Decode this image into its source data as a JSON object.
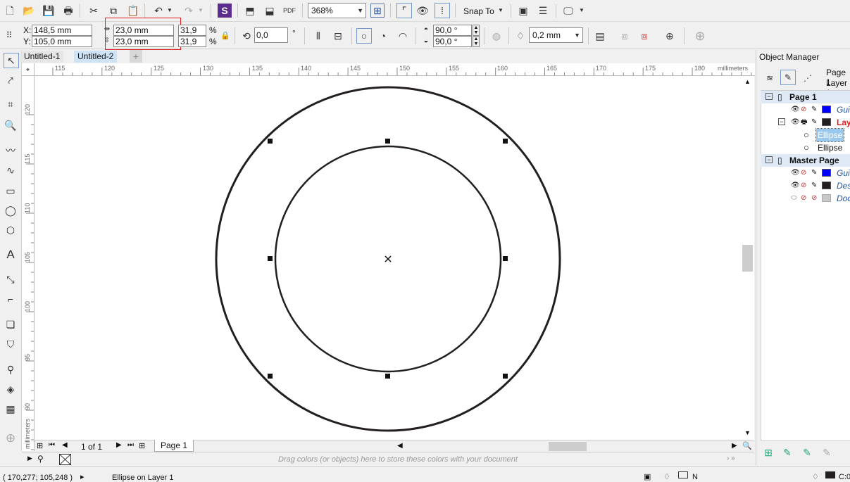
{
  "toolbar": {
    "zoom": "368%",
    "snap_to": "Snap To"
  },
  "property_bar": {
    "x": "148,5 mm",
    "y": "105,0 mm",
    "x_label": "X:",
    "y_label": "Y:",
    "width": "23,0 mm",
    "height": "23,0 mm",
    "scale_w": "31,9",
    "scale_h": "31,9",
    "pct": "%",
    "rotation": "0,0",
    "deg": "°",
    "start_angle": "90,0 °",
    "end_angle": "90,0 °",
    "outline_width": "0,2 mm"
  },
  "doc_tabs": [
    "Untitled-1",
    "Untitled-2"
  ],
  "ruler": {
    "h_ticks": [
      "115",
      "120",
      "125",
      "130",
      "135",
      "140",
      "145",
      "150",
      "155",
      "160",
      "165",
      "170",
      "175",
      "180"
    ],
    "v_ticks": [
      "120",
      "115",
      "110",
      "105",
      "100",
      "95",
      "90"
    ],
    "unit": "millimeters"
  },
  "page_nav": {
    "count": "1 of 1",
    "page_tab": "Page 1"
  },
  "palette_hint": "Drag colors (or objects) here to store these colors with your document",
  "status": {
    "coords": "( 170,277; 105,248 )",
    "object": "Ellipse on Layer 1",
    "fill": "N",
    "outline": "C:0"
  },
  "object_manager": {
    "title": "Object Manager",
    "header_page": "Page 1",
    "header_layer": "Layer 1",
    "rows": [
      {
        "label": "Page 1",
        "kind": "page"
      },
      {
        "label": "Gui",
        "kind": "layer",
        "color": "#0000ff"
      },
      {
        "label": "Lay",
        "kind": "layer-active",
        "color": "#231f20"
      },
      {
        "label": "Ellipse",
        "kind": "object",
        "selected": true
      },
      {
        "label": "Ellipse",
        "kind": "object",
        "selected": false
      },
      {
        "label": "Master Page",
        "kind": "page"
      },
      {
        "label": "Gui",
        "kind": "layer",
        "color": "#0000ff"
      },
      {
        "label": "Des",
        "kind": "layer",
        "color": "#231f20"
      },
      {
        "label": "Doc",
        "kind": "layer",
        "color": "#c8c8c8"
      }
    ]
  },
  "colors": {
    "accent_red": "#e02020",
    "selection_blue": "#99c9ef",
    "guide_blue": "#0000ff",
    "stroke": "#231f20"
  }
}
